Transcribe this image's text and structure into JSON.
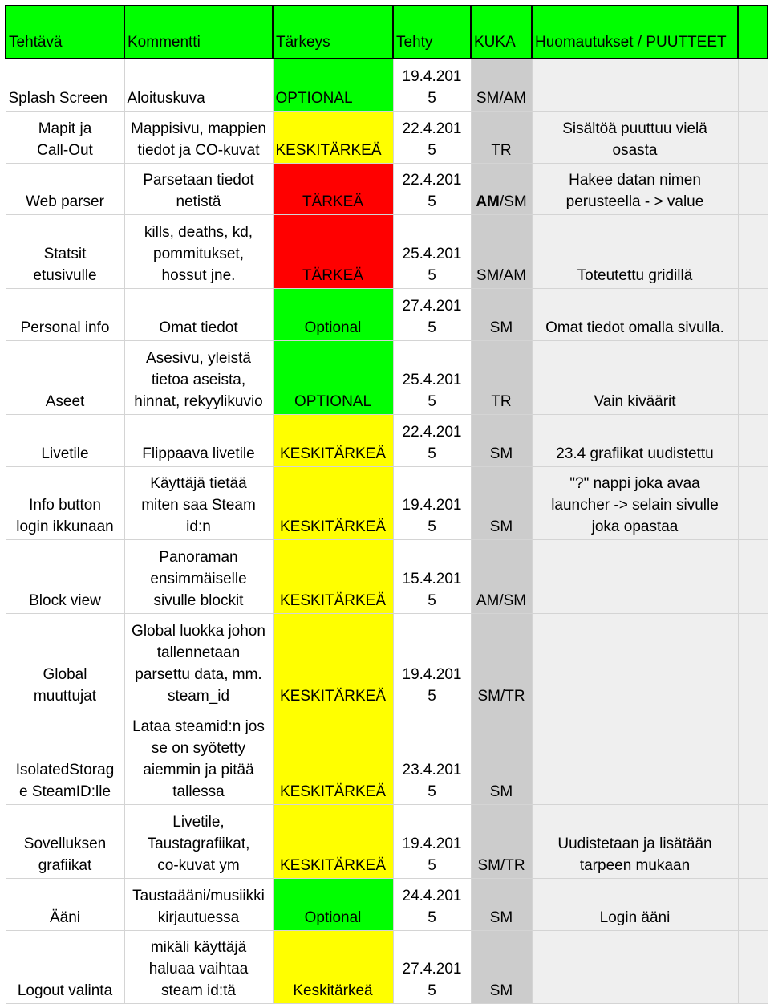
{
  "columns": [
    "Tehtävä",
    "Kommentti",
    "Tärkeys",
    "Tehty",
    "KUKA",
    "Huomautukset / PUUTTEET",
    ""
  ],
  "colors": {
    "header": "#00ff00",
    "optional": "#00ff00",
    "keskitarkea": "#ffff00",
    "tarkea": "#ff0000",
    "kuka": "#cccccc",
    "notes": "#efefef"
  },
  "rows": [
    {
      "task": "Splash Screen",
      "comment": "Aloituskuva",
      "priority": "OPTIONAL",
      "level": "green",
      "done": "19.4.201\n5",
      "who": "SM/AM",
      "note": ""
    },
    {
      "task": "Mapit ja\nCall-Out",
      "comment": "Mappisivu, mappien\ntiedot ja CO-kuvat",
      "priority": "KESKITÄRKEÄ",
      "level": "yellow",
      "done": "22.4.201\n5",
      "who": "TR",
      "note": "Sisältöä puuttuu vielä\nosasta"
    },
    {
      "task": "Web parser",
      "comment": "Parsetaan tiedot\nnetistä",
      "priority": "TÄRKEÄ",
      "level": "red",
      "done": "22.4.201\n5",
      "who": "AM/SM",
      "who_bold": "AM",
      "who_rest": "/SM",
      "note": "Hakee datan nimen\nperusteella - > value"
    },
    {
      "task": "Statsit\netusivulle",
      "comment": "kills, deaths, kd,\npommitukset,\nhossut jne.",
      "priority": "TÄRKEÄ",
      "level": "red",
      "done": "25.4.201\n5",
      "who": "SM/AM",
      "note": "Toteutettu gridillä"
    },
    {
      "task": "Personal info",
      "comment": "Omat tiedot",
      "priority": "Optional",
      "level": "green",
      "done": "27.4.201\n5",
      "who": "SM",
      "note": "Omat tiedot omalla sivulla."
    },
    {
      "task": "Aseet",
      "comment": "Asesivu, yleistä\ntietoa aseista,\nhinnat, rekyylikuvio",
      "priority": "OPTIONAL",
      "level": "green",
      "done": "25.4.201\n5",
      "who": "TR",
      "note": "Vain kiväärit"
    },
    {
      "task": "Livetile",
      "comment": "Flippaava livetile",
      "priority": "KESKITÄRKEÄ",
      "level": "yellow",
      "done": "22.4.201\n5",
      "who": "SM",
      "note": "23.4 grafiikat uudistettu"
    },
    {
      "task": "Info button\nlogin ikkunaan",
      "comment": "Käyttäjä tietää\nmiten saa Steam\nid:n",
      "priority": "KESKITÄRKEÄ",
      "level": "yellow",
      "done": "19.4.201\n5",
      "who": "SM",
      "note": "\"?\" nappi joka avaa\nlauncher -> selain sivulle\njoka opastaa"
    },
    {
      "task": "Block view",
      "comment": "Panoraman\nensimmäiselle\nsivulle blockit",
      "priority": "KESKITÄRKEÄ",
      "level": "yellow",
      "done": "15.4.201\n5",
      "who": "AM/SM",
      "note": ""
    },
    {
      "task": "Global\nmuuttujat",
      "comment": "Global luokka johon\ntallennetaan\nparsettu data, mm.\nsteam_id",
      "priority": "KESKITÄRKEÄ",
      "level": "yellow",
      "done": "19.4.201\n5",
      "who": "SM/TR",
      "note": ""
    },
    {
      "task": "IsolatedStorag\ne SteamID:lle",
      "comment": "Lataa steamid:n jos\nse on syötetty\naiemmin ja pitää\ntallessa",
      "priority": "KESKITÄRKEÄ",
      "level": "yellow",
      "done": "23.4.201\n5",
      "who": "SM",
      "note": ""
    },
    {
      "task": "Sovelluksen\ngrafiikat",
      "comment": "Livetile,\nTaustagrafiikat,\nco-kuvat ym",
      "priority": "KESKITÄRKEÄ",
      "level": "yellow",
      "done": "19.4.201\n5",
      "who": "SM/TR",
      "note": "Uudistetaan ja lisätään\ntarpeen mukaan"
    },
    {
      "task": "Ääni",
      "comment": "Taustaääni/musiikki\nkirjautuessa",
      "priority": "Optional",
      "level": "green",
      "done": "24.4.201\n5",
      "who": "SM",
      "note": "Login ääni"
    },
    {
      "task": "Logout valinta",
      "comment": "mikäli käyttäjä\nhaluaa vaihtaa\nsteam id:tä",
      "priority": "Keskitärkeä",
      "level": "yellow",
      "done": "27.4.201\n5",
      "who": "SM",
      "note": ""
    }
  ]
}
